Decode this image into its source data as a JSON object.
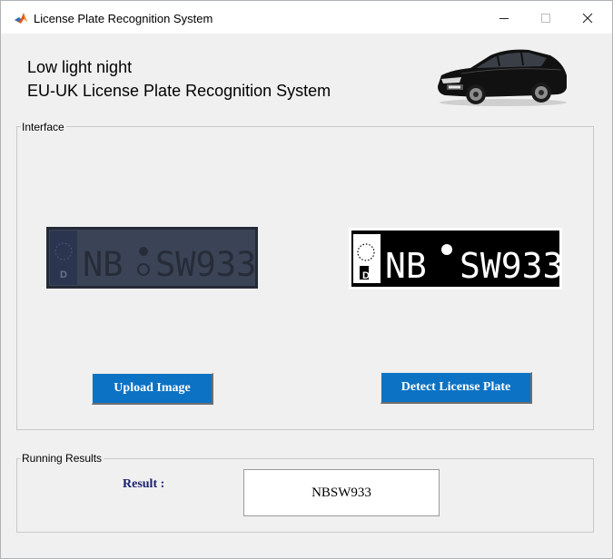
{
  "window": {
    "title": "License Plate Recognition System",
    "app_icon": "matlab-icon",
    "controls": [
      "minimize-icon",
      "maximize-icon",
      "close-icon"
    ]
  },
  "header": {
    "line1": "Low light night",
    "line2": "EU-UK License Plate Recognition System",
    "image": "black-sedan-car"
  },
  "interface_panel": {
    "label": "Interface",
    "input_plate": {
      "country_code": "D",
      "left_text": "NB",
      "right_text": "SW933"
    },
    "binary_plate": {
      "country_code": "D",
      "left_text": "NB",
      "right_text": "SW933"
    },
    "upload_button": "Upload Image",
    "detect_button": "Detect License Plate"
  },
  "results_panel": {
    "label": "Running Results",
    "result_label": "Result :",
    "result_value": "NBSW933"
  },
  "colors": {
    "button_bg": "#0b72c4",
    "button_text": "#ffffff",
    "result_label": "#1a1f6e",
    "window_bg": "#f0f0f0"
  }
}
